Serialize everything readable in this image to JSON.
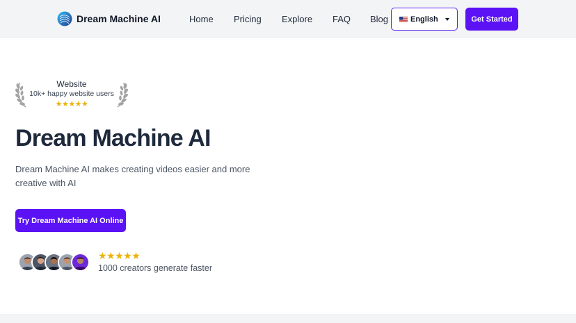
{
  "header": {
    "brand_name": "Dream Machine AI",
    "nav": [
      {
        "label": "Home"
      },
      {
        "label": "Pricing"
      },
      {
        "label": "Explore"
      },
      {
        "label": "FAQ"
      },
      {
        "label": "Blog"
      }
    ],
    "language": {
      "flag": "us-flag",
      "selected": "English"
    },
    "cta_label": "Get Started"
  },
  "badge": {
    "title": "Website",
    "subtitle": "10k+ happy website users",
    "stars": "★★★★★",
    "rating_stars": 5
  },
  "hero": {
    "title": "Dream Machine AI",
    "description": "Dream Machine AI makes creating videos easier and more creative with AI",
    "cta_label": "Try Dream Machine AI Online"
  },
  "social_proof": {
    "avatar_count": 5,
    "stars": "★★★★★",
    "rating_stars": 5,
    "text": "1000 creators generate faster"
  },
  "colors": {
    "accent": "#5b12f5",
    "star": "#eab308",
    "nav_bg": "#f3f4f6",
    "title": "#1e293b"
  }
}
